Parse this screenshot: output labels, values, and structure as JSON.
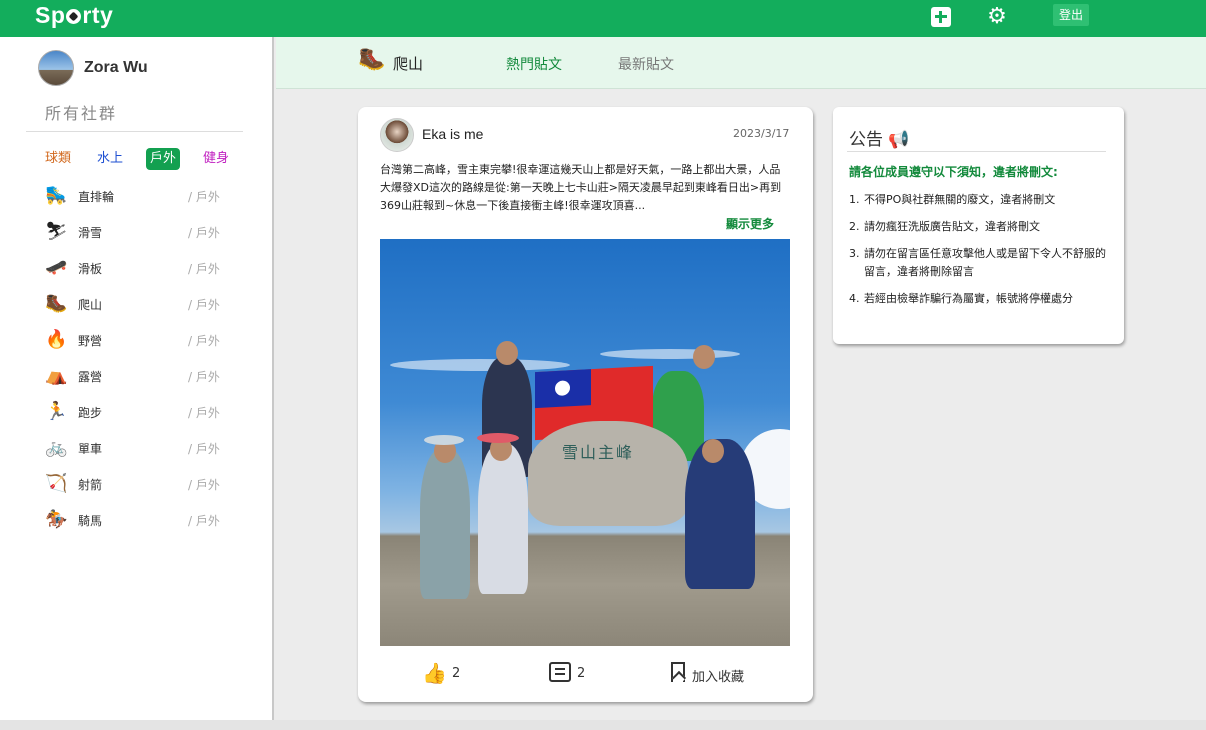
{
  "app": {
    "logo": "Sporty"
  },
  "topbar": {
    "logout_label": "登出",
    "add_icon": "plus-square-icon",
    "settings_icon": "gear-icon"
  },
  "sidebar": {
    "user_name": "Zora Wu",
    "all_groups_label": "所有社群",
    "category_tabs": [
      "球類",
      "水上",
      "戶外",
      "健身"
    ],
    "active_category": "戶外",
    "items": [
      {
        "icon": "inline-skate-icon",
        "glyph": "🛼",
        "label": "直排輪",
        "category": "/ 戶外"
      },
      {
        "icon": "skier-icon",
        "glyph": "⛷",
        "label": "滑雪",
        "category": "/ 戶外"
      },
      {
        "icon": "skateboard-icon",
        "glyph": "🛹",
        "label": "滑板",
        "category": "/ 戶外"
      },
      {
        "icon": "hiker-icon",
        "glyph": "🥾",
        "label": "爬山",
        "category": "/ 戶外"
      },
      {
        "icon": "campfire-icon",
        "glyph": "🔥",
        "label": "野營",
        "category": "/ 戶外"
      },
      {
        "icon": "tent-icon",
        "glyph": "⛺",
        "label": "露營",
        "category": "/ 戶外"
      },
      {
        "icon": "runner-icon",
        "glyph": "🏃",
        "label": "跑步",
        "category": "/ 戶外"
      },
      {
        "icon": "bicycle-icon",
        "glyph": "🚲",
        "label": "單車",
        "category": "/ 戶外"
      },
      {
        "icon": "bow-arrow-icon",
        "glyph": "🏹",
        "label": "射箭",
        "category": "/ 戶外"
      },
      {
        "icon": "horse-riding-icon",
        "glyph": "🏇",
        "label": "騎馬",
        "category": "/ 戶外"
      }
    ]
  },
  "group_header": {
    "title": "爬山",
    "icon": "hiker-icon",
    "tabs": [
      "熱門貼文",
      "最新貼文"
    ],
    "active_tab": "熱門貼文"
  },
  "post": {
    "author": "Eka is me",
    "date": "2023/3/17",
    "text": "台灣第二高峰，雪主東完攀!很幸運這幾天山上都是好天氣，一路上都出大景，人品大爆發XD這次的路線是從:第一天晚上七卡山莊>隔天凌晨早起到東峰看日出>再到369山莊報到~休息一下後直接衝主峰!很幸運攻頂喜...",
    "show_more": "顯示更多",
    "photo_sign_text": "雪山主峰",
    "likes": "2",
    "comments": "2",
    "bookmark_label": "加入收藏"
  },
  "notice": {
    "title": "公告",
    "title_icon": "megaphone-icon",
    "heading": "請各位成員遵守以下須知，違者將刪文:",
    "rules": [
      {
        "num": "1.",
        "text": "不得PO與社群無關的廢文，違者將刪文"
      },
      {
        "num": "2.",
        "text": "請勿瘋狂洗版廣告貼文，違者將刪文"
      },
      {
        "num": "3.",
        "text": "請勿在留言區任意攻擊他人或是留下令人不舒服的留言，違者將刪除留言"
      },
      {
        "num": "4.",
        "text": "若經由檢舉詐騙行為屬實，帳號將停權處分"
      }
    ]
  },
  "colors": {
    "brand": "#13ad5c",
    "accent_text": "#138a3c"
  }
}
